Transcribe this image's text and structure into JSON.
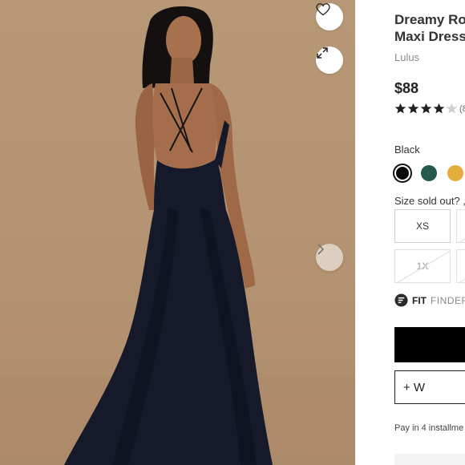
{
  "product": {
    "title_line1": "Dreamy Ro",
    "title_line2": "Maxi Dress",
    "brand": "Lulus",
    "price": "$88",
    "rating": 4,
    "rating_max": 5,
    "review_count": "(8"
  },
  "color": {
    "label": "Black",
    "swatches": [
      {
        "name": "black",
        "hex": "#0b0b0b",
        "selected": true
      },
      {
        "name": "emerald",
        "hex": "#255a4a",
        "selected": false
      },
      {
        "name": "mustard",
        "hex": "#e2ad3c",
        "selected": false
      }
    ]
  },
  "size": {
    "label": "Size sold out? ,",
    "options": [
      "XS",
      "1X"
    ]
  },
  "fit_finder": {
    "strong": "FIT",
    "light": "FINDER"
  },
  "actions": {
    "wishlist_label": "+ W"
  },
  "payment": {
    "text": "Pay in 4 installme"
  },
  "icons": {
    "favorite": "heart-icon",
    "expand": "expand-arrows-icon",
    "next": "chevron-right-icon",
    "fit_finder": "fit-finder-logo-icon"
  }
}
